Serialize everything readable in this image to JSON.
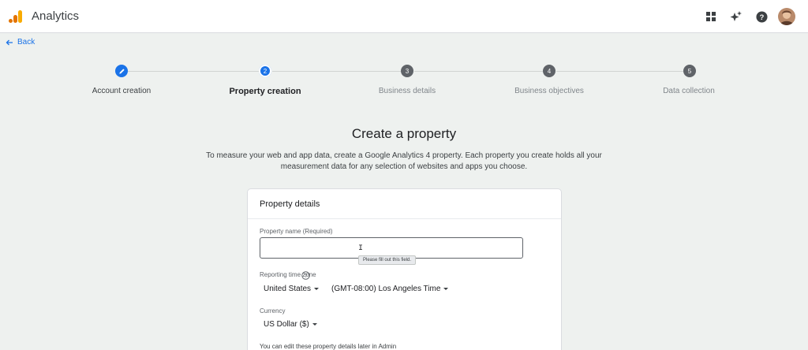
{
  "header": {
    "app_title": "Analytics",
    "icons": [
      "apps-grid-icon",
      "sparkle-icon",
      "help-icon",
      "avatar"
    ],
    "logo_colors": [
      "#f9ab00",
      "#e37400"
    ]
  },
  "nav": {
    "back_label": "Back"
  },
  "stepper": {
    "steps": [
      {
        "number": "",
        "label": "Account creation",
        "state": "done"
      },
      {
        "number": "2",
        "label": "Property creation",
        "state": "active"
      },
      {
        "number": "3",
        "label": "Business details",
        "state": "todo"
      },
      {
        "number": "4",
        "label": "Business objectives",
        "state": "todo"
      },
      {
        "number": "5",
        "label": "Data collection",
        "state": "todo"
      }
    ]
  },
  "main": {
    "title": "Create a property",
    "description_line1": "To measure your web and app data, create a Google Analytics 4 property. Each property you create holds all your",
    "description_line2": "measurement data for any selection of websites and apps you choose."
  },
  "card": {
    "title": "Property details",
    "property_name_label": "Property name (Required)",
    "property_name_value": "",
    "validation_tooltip": "Please fill out this field.",
    "time_zone_label": "Reporting time zone",
    "country_value": "United States",
    "time_zone_value": "(GMT-08:00) Los Angeles Time",
    "currency_label": "Currency",
    "currency_value": "US Dollar ($)",
    "footer_note": "You can edit these property details later in Admin"
  },
  "colors": {
    "accent": "#1a73e8",
    "background": "#eef1ef"
  }
}
